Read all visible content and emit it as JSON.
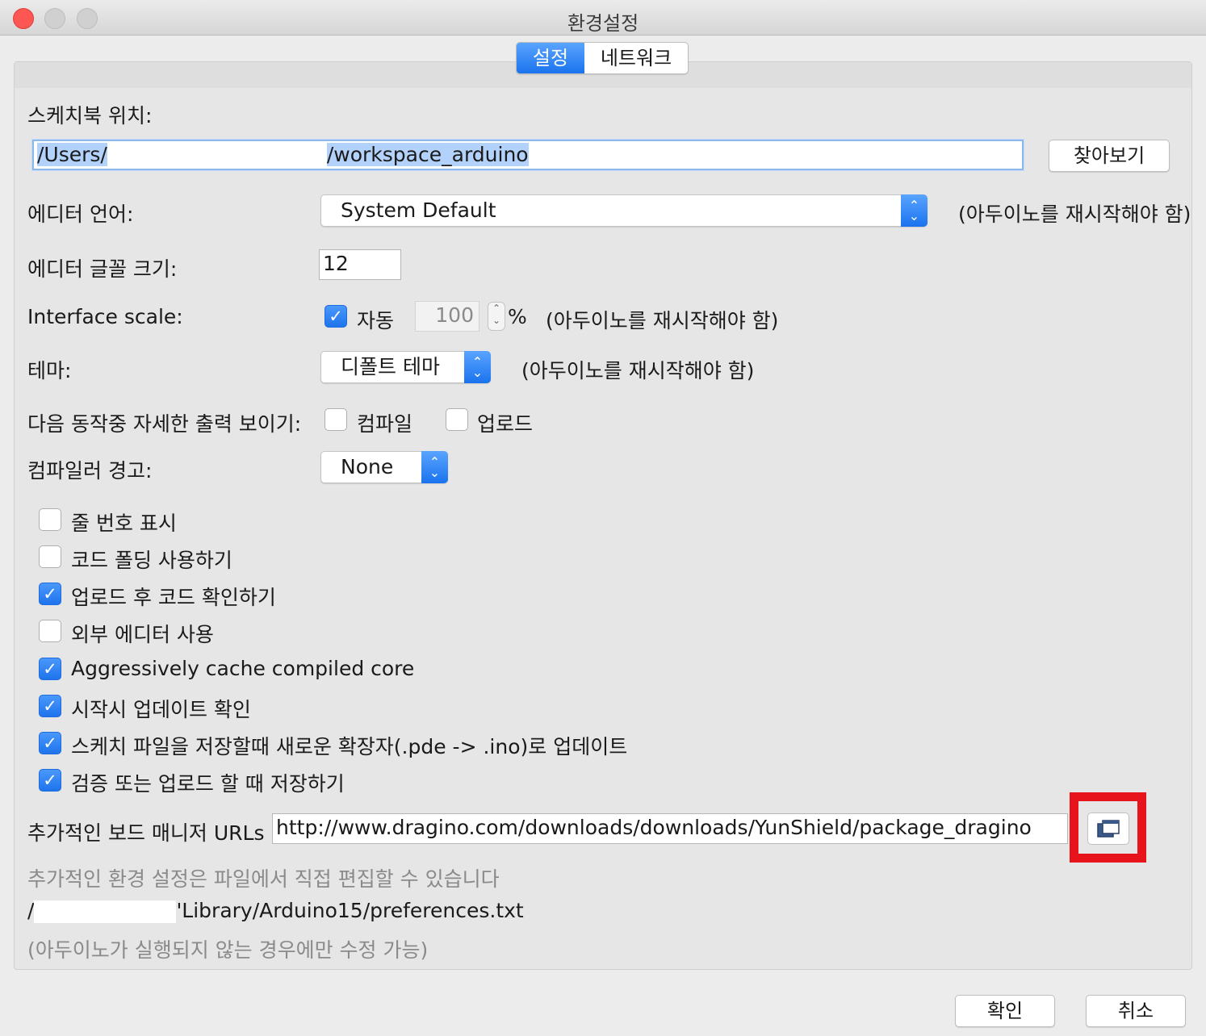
{
  "window": {
    "title": "환경설정"
  },
  "tabs": [
    {
      "label": "설정",
      "active": true
    },
    {
      "label": "네트워크",
      "active": false
    }
  ],
  "sketchbook": {
    "label": "스케치북 위치:",
    "path_start": "/Users/",
    "path_end": "/workspace_arduino",
    "browse_label": "찾아보기"
  },
  "editor_language": {
    "label": "에디터 언어:",
    "value": "System Default",
    "note": "(아두이노를 재시작해야 함)"
  },
  "editor_font_size": {
    "label": "에디터 글꼴 크기:",
    "value": "12"
  },
  "interface_scale": {
    "label": "Interface scale:",
    "auto_label": "자동",
    "auto_checked": true,
    "value": "100",
    "unit": "%",
    "note": "(아두이노를 재시작해야 함)"
  },
  "theme": {
    "label": "테마:",
    "value": "디폴트 테마",
    "note": "(아두이노를 재시작해야 함)"
  },
  "verbose": {
    "label": "다음 동작중 자세한  출력 보이기:",
    "compile_label": "컴파일",
    "upload_label": "업로드"
  },
  "compiler_warnings": {
    "label": "컴파일러 경고:",
    "value": "None"
  },
  "options": [
    {
      "label": "줄 번호 표시",
      "checked": false
    },
    {
      "label": "코드 폴딩 사용하기",
      "checked": false
    },
    {
      "label": "업로드 후 코드 확인하기",
      "checked": true
    },
    {
      "label": "외부 에디터 사용",
      "checked": false
    },
    {
      "label": "Aggressively cache compiled core",
      "checked": true
    },
    {
      "label": "시작시 업데이트 확인",
      "checked": true
    },
    {
      "label": "스케치 파일을 저장할때 새로운 확장자(.pde -> .ino)로 업데이트",
      "checked": true
    },
    {
      "label": "검증 또는 업로드 할 때 저장하기",
      "checked": true
    }
  ],
  "board_urls": {
    "label": "추가적인 보드 매니저 URLs",
    "value": "http://www.dragino.com/downloads/downloads/YunShield/package_dragino",
    "icon": "window-stack-icon"
  },
  "prefs_file": {
    "hint": "추가적인 환경 설정은 파일에서 직접 편집할 수 있습니다",
    "path_start": "/",
    "path_end": "'Library/Arduino15/preferences.txt",
    "note": "(아두이노가 실행되지 않는 경우에만 수정 가능)"
  },
  "footer": {
    "ok_label": "확인",
    "cancel_label": "취소"
  },
  "colors": {
    "accent": "#1a73ee",
    "highlight": "#e8141b",
    "selection": "#b3d2fb"
  }
}
